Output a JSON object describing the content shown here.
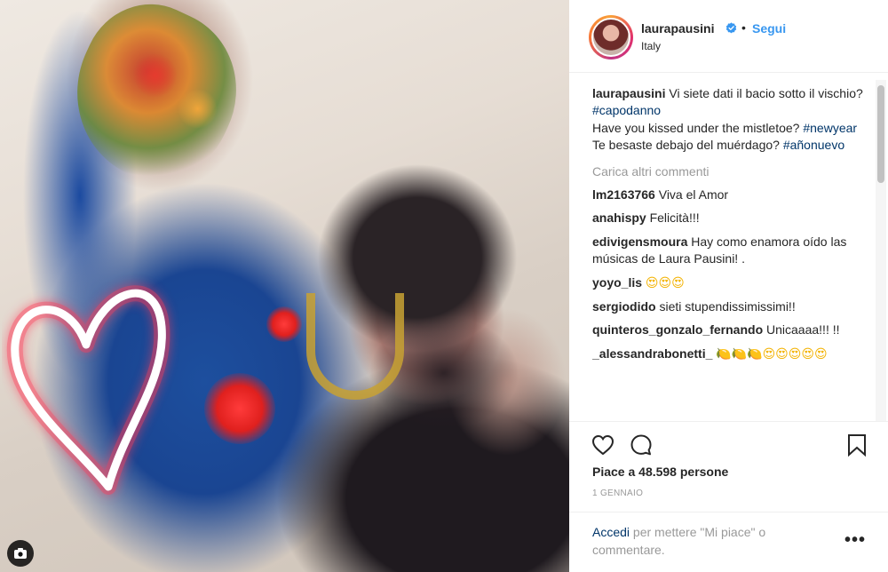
{
  "post": {
    "username": "laurapausini",
    "follow_label": "Segui",
    "dot": "•",
    "location": "Italy",
    "verified_icon": "verified-badge-icon"
  },
  "caption": {
    "username": "laurapausini",
    "line1": "Vi siete dati il bacio sotto il vischio?",
    "tag1": "#capodanno",
    "line2": "Have you kissed under the mistletoe?",
    "tag2": "#newyear",
    "line3": "Te besaste debajo del muérdago?",
    "tag3": "#añonuevo"
  },
  "load_more_label": "Carica altri commenti",
  "comments": [
    {
      "user": "lm2163766",
      "text": "Viva el Amor"
    },
    {
      "user": "anahispy",
      "text": "Felicità!!!"
    },
    {
      "user": "edivigensmoura",
      "text": "Hay como enamora oído las músicas de Laura Pausini! ."
    },
    {
      "user": "yoyo_lis",
      "text": "😍😍😍"
    },
    {
      "user": "sergiodido",
      "text": "sieti stupendissimissimi!!"
    },
    {
      "user": "quinteros_gonzalo_fernando",
      "text": "Unicaaaa!!! !!"
    },
    {
      "user": "_alessandrabonetti_",
      "text": "🍋🍋🍋😍😍😍😍😍"
    }
  ],
  "likes_label": "Piace a 48.598 persone",
  "date_label": "1 GENNAIO",
  "footer": {
    "login_label": "Accedi",
    "login_rest": "per mettere \"Mi piace\" o commentare.",
    "more_label": "•••"
  },
  "icons": {
    "like": "heart-outline-icon",
    "comment": "comment-bubble-icon",
    "save": "bookmark-icon",
    "camera": "camera-icon"
  },
  "colors": {
    "link_blue": "#3897f0",
    "hashtag": "#003569",
    "muted": "#999999"
  }
}
